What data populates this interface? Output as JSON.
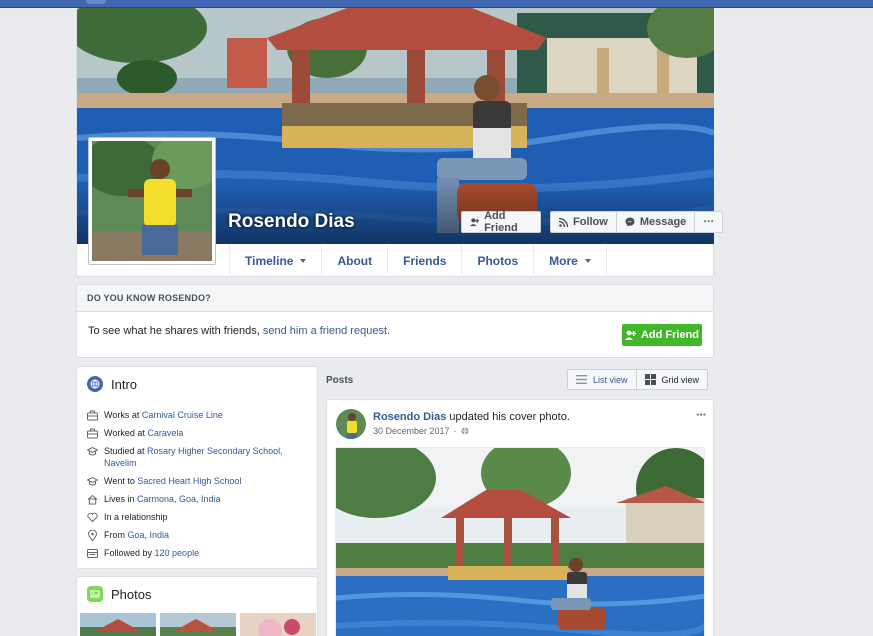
{
  "profile": {
    "name": "Rosendo Dias"
  },
  "cover_actions": {
    "add_friend": "Add Friend",
    "follow": "Follow",
    "message": "Message",
    "more": "···"
  },
  "tabs": [
    {
      "label": "Timeline",
      "has_menu": true
    },
    {
      "label": "About"
    },
    {
      "label": "Friends"
    },
    {
      "label": "Photos"
    },
    {
      "label": "More",
      "has_menu": true
    }
  ],
  "know_box": {
    "heading": "DO YOU KNOW ROSENDO?",
    "text": "To see what he shares with friends, ",
    "link": "send him a friend request.",
    "button": "Add Friend"
  },
  "intro": {
    "title": "Intro",
    "items": [
      {
        "icon": "briefcase-icon",
        "prefix": "Works at ",
        "link": "Carnival Cruise Line"
      },
      {
        "icon": "briefcase-icon",
        "prefix": "Worked at ",
        "link": "Caravela"
      },
      {
        "icon": "graduation-cap-icon",
        "prefix": "Studied at ",
        "link": "Rosary Higher Secondary School, Navelim"
      },
      {
        "icon": "graduation-cap-icon",
        "prefix": "Went to ",
        "link": "Sacred Heart High School"
      },
      {
        "icon": "house-icon",
        "prefix": "Lives in ",
        "link": "Carmona, Goa, India"
      },
      {
        "icon": "heart-icon",
        "prefix": "In a relationship",
        "link": ""
      },
      {
        "icon": "location-pin-icon",
        "prefix": "From ",
        "link": "Goa, India"
      },
      {
        "icon": "followers-icon",
        "prefix": "Followed by ",
        "link": "120 people"
      }
    ]
  },
  "photos": {
    "title": "Photos"
  },
  "posts": {
    "label": "Posts",
    "list_view": "List view",
    "grid_view": "Grid view",
    "post": {
      "author": "Rosendo Dias",
      "action": " updated his cover photo.",
      "date": "30 December 2017",
      "separator": "·",
      "more": "···"
    }
  },
  "colors": {
    "brand_blue": "#4267b2",
    "link_blue": "#365899",
    "green": "#42b72a"
  }
}
